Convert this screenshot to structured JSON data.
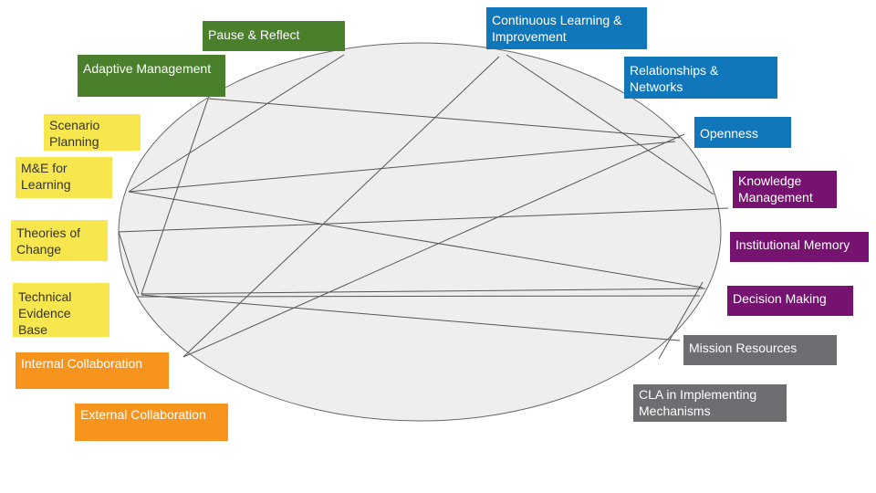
{
  "colors": {
    "green": "#4a7f2c",
    "yellow": "#f7e64e",
    "orange": "#f7941e",
    "blue": "#1177bb",
    "purple": "#76126f",
    "gray": "#6e6d72",
    "ellipse": "#eeeeee"
  },
  "labels": {
    "pause_reflect": "Pause & Reflect",
    "adaptive_management": "Adaptive Management",
    "scenario_planning": "Scenario Planning",
    "me_learning": "M&E for Learning",
    "theories_of_change": "Theories of Change",
    "technical_evidence": "Technical Evidence Base",
    "internal_collaboration": "Internal Collaboration",
    "external_collaboration": "External Collaboration",
    "continuous_learning": "Continuous Learning & Improvement",
    "relationships_networks": "Relationships & Networks",
    "openness": "Openness",
    "knowledge_management": "Knowledge Management",
    "institutional_memory": "Institutional Memory",
    "decision_making": "Decision Making",
    "mission_resources": "Mission Resources",
    "cla_mechanisms": "CLA in Implementing Mechanisms"
  }
}
